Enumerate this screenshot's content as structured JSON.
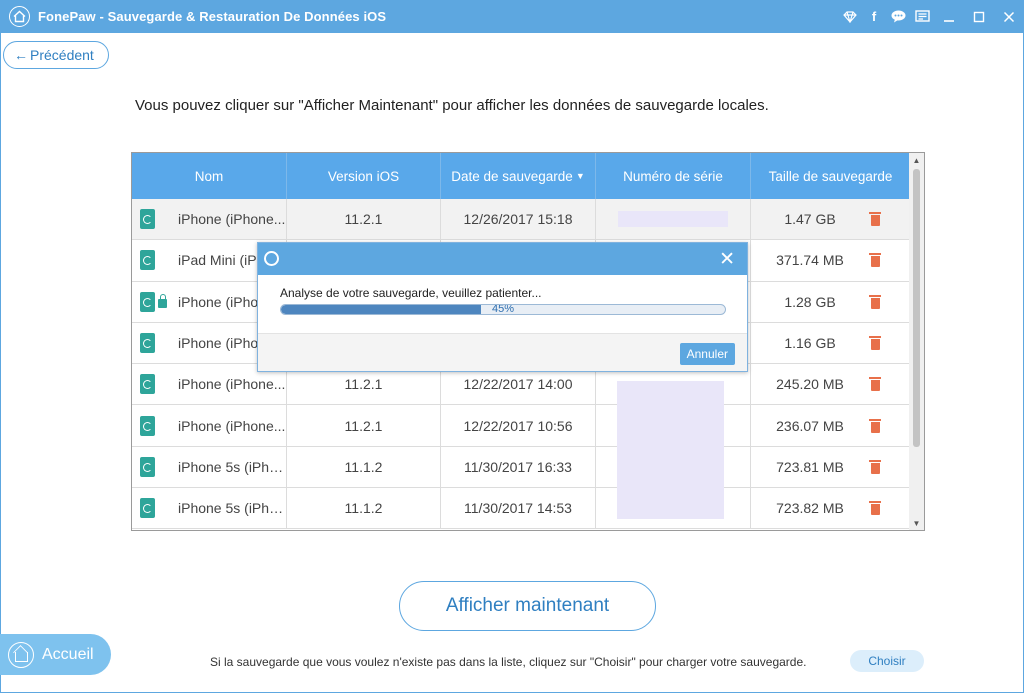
{
  "window": {
    "title": "FonePaw - Sauvegarde & Restauration De Données iOS",
    "icons": [
      "diamond-icon",
      "facebook-icon",
      "chat-icon",
      "feedback-icon"
    ],
    "controls": [
      "minimize",
      "maximize",
      "close"
    ]
  },
  "nav": {
    "back_label": "Précédent"
  },
  "intro_text": "Vous pouvez cliquer sur \"Afficher Maintenant\" pour afficher les données de sauvegarde locales.",
  "table": {
    "columns": [
      "Nom",
      "Version iOS",
      "Date de sauvegarde",
      "Numéro de série",
      "Taille de sauvegarde"
    ],
    "sorted_column": "Date de sauvegarde",
    "rows": [
      {
        "name": "iPhone (iPhone...",
        "version": "11.2.1",
        "date": "12/26/2017 15:18",
        "size": "1.47 GB",
        "locked": false
      },
      {
        "name": "iPad Mini (iPa",
        "version": "",
        "date": "",
        "size": "371.74 MB",
        "locked": false
      },
      {
        "name": "iPhone (iPho",
        "version": "",
        "date": "",
        "size": "1.28 GB",
        "locked": true
      },
      {
        "name": "iPhone (iPho",
        "version": "",
        "date": "",
        "size": "1.16 GB",
        "locked": false
      },
      {
        "name": "iPhone (iPhone...",
        "version": "11.2.1",
        "date": "12/22/2017 14:00",
        "size": "245.20 MB",
        "locked": false
      },
      {
        "name": "iPhone (iPhone...",
        "version": "11.2.1",
        "date": "12/22/2017 10:56",
        "size": "236.07 MB",
        "locked": false
      },
      {
        "name": "iPhone 5s (iPho...",
        "version": "11.1.2",
        "date": "11/30/2017 16:33",
        "size": "723.81 MB",
        "locked": false
      },
      {
        "name": "iPhone 5s (iPho...",
        "version": "11.1.2",
        "date": "11/30/2017 14:53",
        "size": "723.82 MB",
        "locked": false
      }
    ]
  },
  "modal": {
    "message": "Analyse de votre sauvegarde, veuillez patienter...",
    "progress_percent": 45,
    "progress_label": "45%",
    "cancel_label": "Annuler"
  },
  "actions": {
    "show_now_label": "Afficher maintenant",
    "home_label": "Accueil",
    "hint_text": "Si la sauvegarde que vous voulez n'existe pas dans la liste, cliquez sur \"Choisir\" pour charger votre sauvegarde.",
    "choose_label": "Choisir"
  },
  "colors": {
    "accent": "#5da7e0",
    "table_header": "#59a8ea",
    "file_icon": "#2ea59a",
    "delete_icon": "#e8704a",
    "serial_mask": "#e9e6f9"
  }
}
